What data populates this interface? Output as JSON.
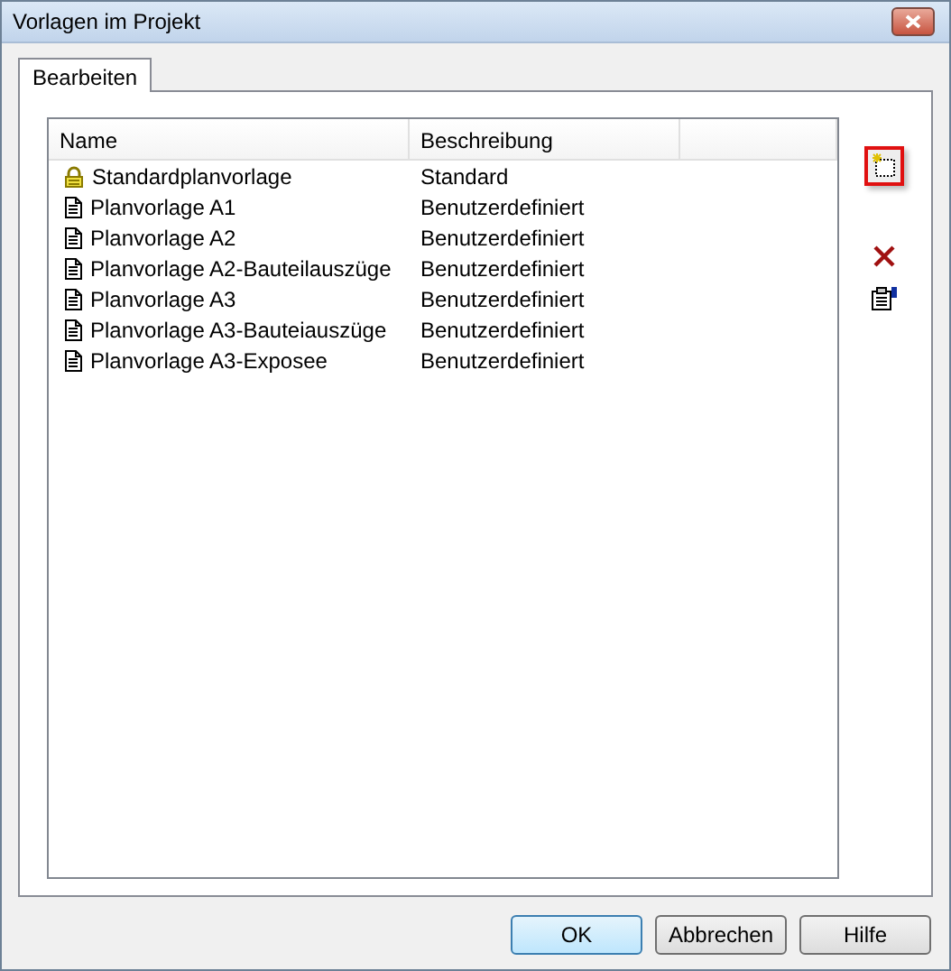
{
  "window": {
    "title": "Vorlagen im Projekt"
  },
  "tabs": [
    {
      "label": "Bearbeiten",
      "selected": true
    }
  ],
  "table": {
    "columns": [
      "Name",
      "Beschreibung"
    ],
    "rows": [
      {
        "kind": "lock",
        "name": "Standardplanvorlage",
        "description": "Standard"
      },
      {
        "kind": "document",
        "name": "Planvorlage A1",
        "description": "Benutzerdefiniert"
      },
      {
        "kind": "document",
        "name": "Planvorlage A2",
        "description": "Benutzerdefiniert"
      },
      {
        "kind": "document",
        "name": "Planvorlage A2-Bauteilauszüge",
        "description": "Benutzerdefiniert"
      },
      {
        "kind": "document",
        "name": "Planvorlage A3",
        "description": "Benutzerdefiniert"
      },
      {
        "kind": "document",
        "name": "Planvorlage A3-Bauteiauszüge",
        "description": "Benutzerdefiniert"
      },
      {
        "kind": "document",
        "name": "Planvorlage A3-Exposee",
        "description": "Benutzerdefiniert"
      }
    ]
  },
  "side_buttons": [
    {
      "kind": "new",
      "highlighted": true
    },
    {
      "kind": "delete",
      "highlighted": false
    },
    {
      "kind": "properties",
      "highlighted": false
    }
  ],
  "buttons": [
    {
      "label": "OK",
      "default": true
    },
    {
      "label": "Abbrechen",
      "default": false
    },
    {
      "label": "Hilfe",
      "default": false
    }
  ]
}
